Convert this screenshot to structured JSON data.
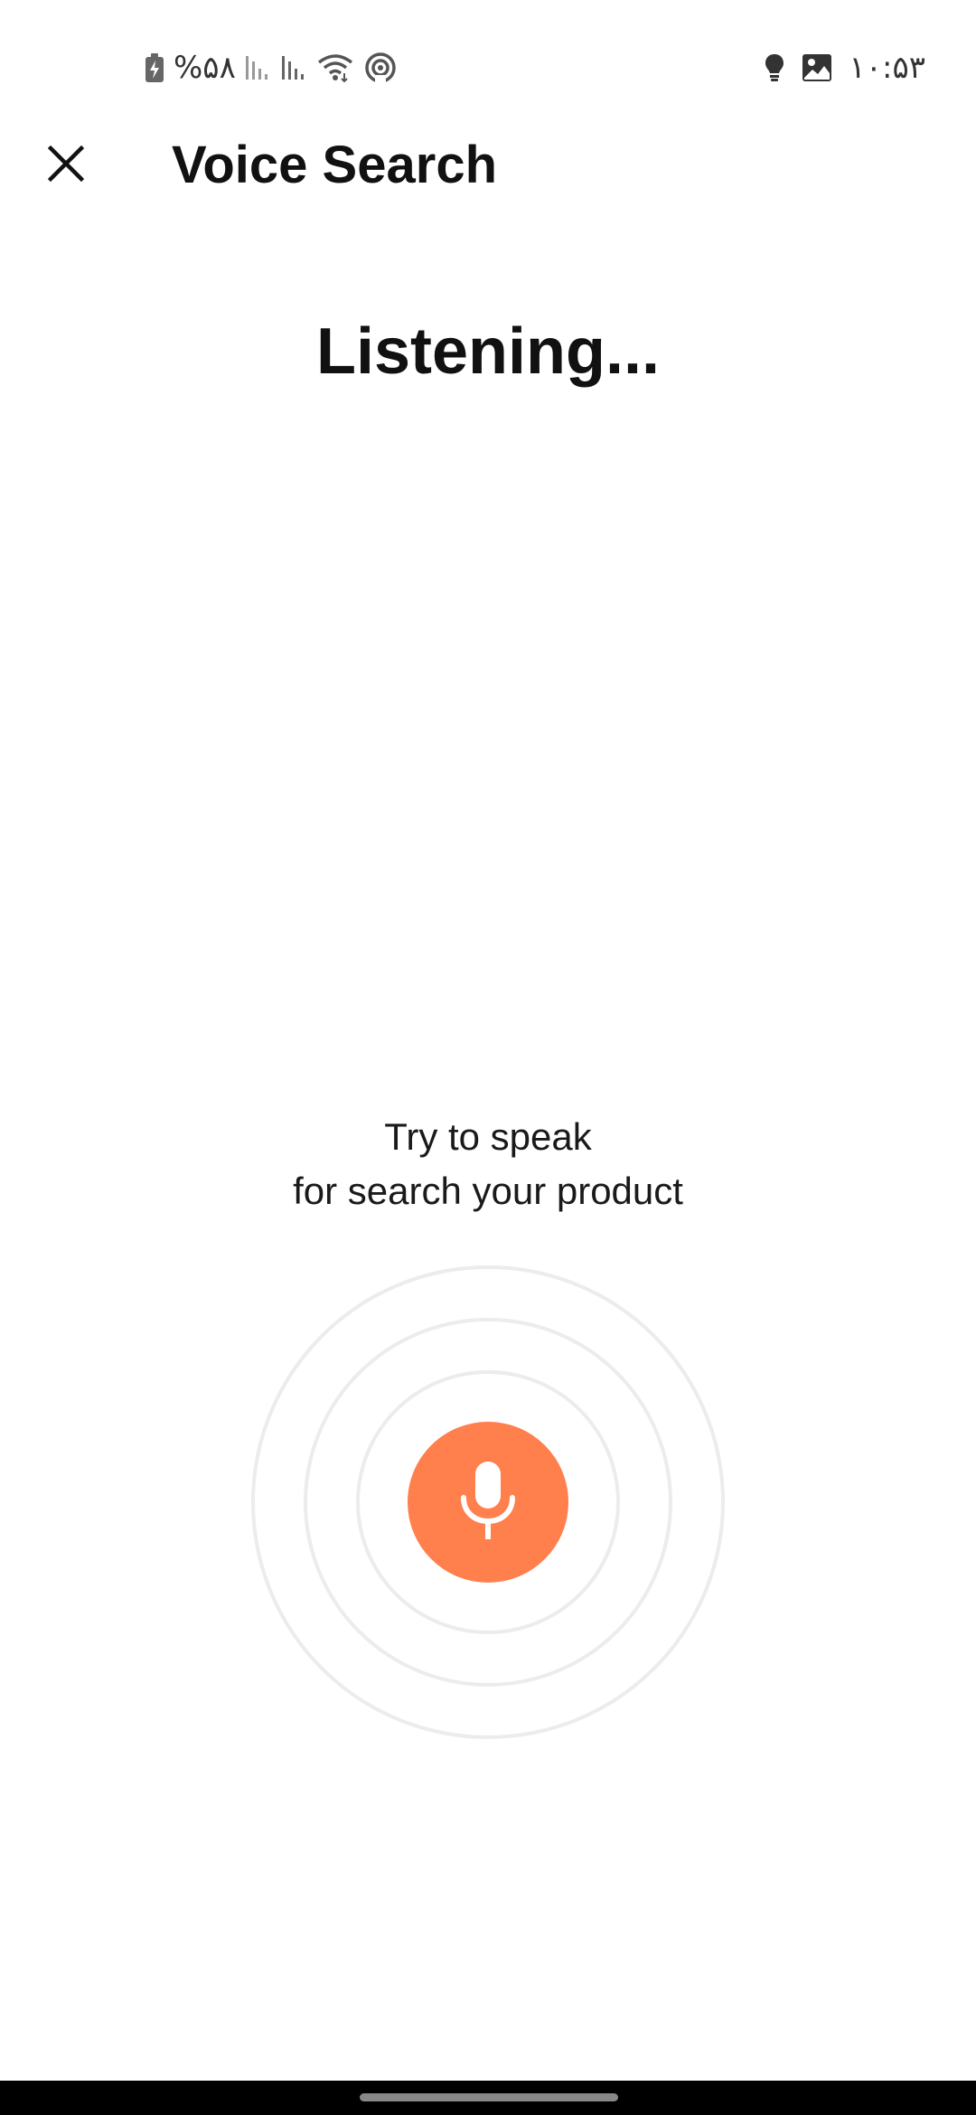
{
  "status_bar": {
    "battery_text": "%۵۸",
    "time": "۱۰:۵۳",
    "icons": [
      "battery-charging-icon",
      "signal-icon",
      "signal-icon",
      "wifi-icon",
      "hotspot-icon",
      "notification-bulb-icon",
      "gallery-icon"
    ]
  },
  "header": {
    "title": "Voice Search",
    "close_icon": "close-icon"
  },
  "main": {
    "status_text": "Listening...",
    "hint_line_1": "Try to speak",
    "hint_line_2": "for search your product",
    "mic_icon": "microphone-icon"
  },
  "colors": {
    "accent": "#FF7F4D",
    "ring": "#ECECEC",
    "text": "#111111"
  }
}
